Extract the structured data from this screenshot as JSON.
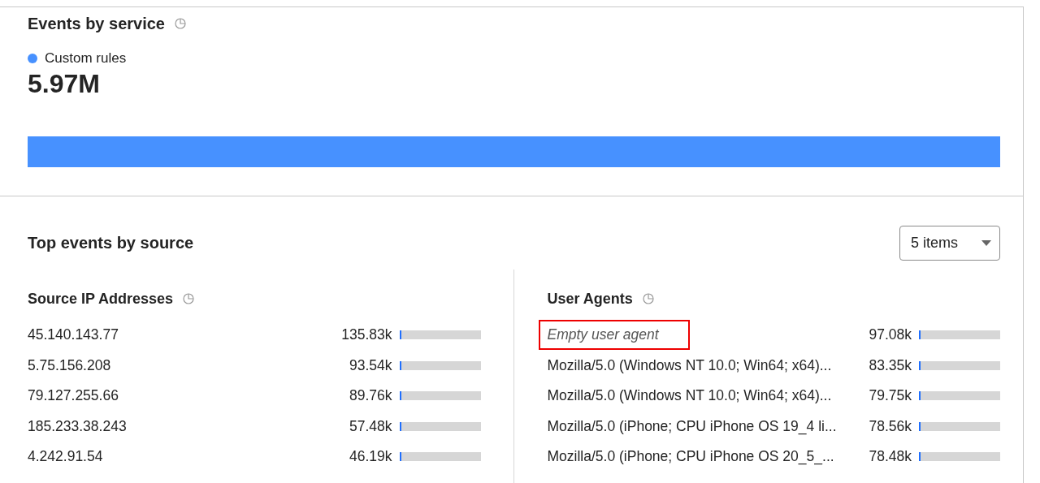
{
  "events_by_service": {
    "title": "Events by service",
    "services": [
      {
        "name": "Custom rules",
        "value": "5.97M",
        "color": "#4791ff",
        "level": 1
      }
    ]
  },
  "top_events": {
    "title": "Top events by source",
    "items_dropdown": {
      "value": "5 items"
    },
    "panels": [
      {
        "title": "Source IP Addresses",
        "rows": [
          {
            "label": "45.140.143.77",
            "value": "135.83k",
            "level": 0.02,
            "italic": false,
            "highlighted": false
          },
          {
            "label": "5.75.156.208",
            "value": "93.54k",
            "level": 0.02,
            "italic": false,
            "highlighted": false
          },
          {
            "label": "79.127.255.66",
            "value": "89.76k",
            "level": 0.02,
            "italic": false,
            "highlighted": false
          },
          {
            "label": "185.233.38.243",
            "value": "57.48k",
            "level": 0.01,
            "italic": false,
            "highlighted": false
          },
          {
            "label": "4.242.91.54",
            "value": "46.19k",
            "level": 0.01,
            "italic": false,
            "highlighted": false
          }
        ]
      },
      {
        "title": "User Agents",
        "rows": [
          {
            "label": "Empty user agent",
            "value": "97.08k",
            "level": 0.02,
            "italic": true,
            "highlighted": true
          },
          {
            "label": "Mozilla/5.0 (Windows NT 10.0; Win64; x64)...",
            "value": "83.35k",
            "level": 0.02,
            "italic": false,
            "highlighted": false
          },
          {
            "label": "Mozilla/5.0 (Windows NT 10.0; Win64; x64)...",
            "value": "79.75k",
            "level": 0.02,
            "italic": false,
            "highlighted": false
          },
          {
            "label": "Mozilla/5.0 (iPhone; CPU iPhone OS 19_4 li...",
            "value": "78.56k",
            "level": 0.02,
            "italic": false,
            "highlighted": false
          },
          {
            "label": "Mozilla/5.0 (iPhone; CPU iPhone OS 20_5_...",
            "value": "78.48k",
            "level": 0.02,
            "italic": false,
            "highlighted": false
          }
        ]
      }
    ]
  }
}
